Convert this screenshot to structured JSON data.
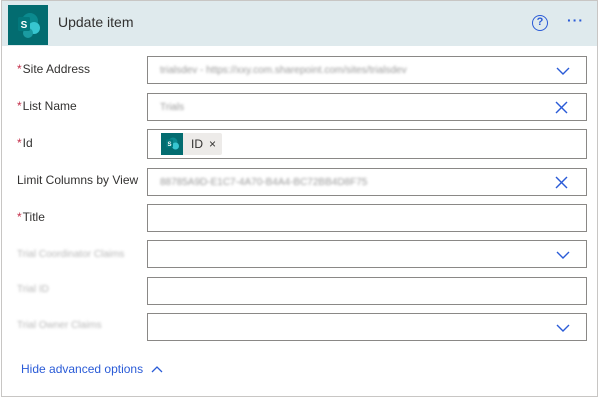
{
  "header": {
    "title": "Update item",
    "help_glyph": "?",
    "more_glyph": "···"
  },
  "fields": {
    "site_address": {
      "label": "Site Address",
      "required": "*",
      "value": "trialsdev - https://xxy.com.sharepoint.com/sites/trialsdev"
    },
    "list_name": {
      "label": "List Name",
      "required": "*",
      "value": "Trials"
    },
    "id": {
      "label": "Id",
      "required": "*",
      "token_label": "ID",
      "token_remove": "×"
    },
    "limit_columns": {
      "label": "Limit Columns by View",
      "value": "88785A9D-E1C7-4A70-B4A4-BC72BB4D8F75"
    },
    "title": {
      "label": "Title",
      "required": "*",
      "value": ""
    },
    "trial_coordinator_claims": {
      "label": "Trial Coordinator Claims"
    },
    "trial_id": {
      "label": "Trial ID"
    },
    "trial_owner_claims": {
      "label": "Trial Owner Claims"
    }
  },
  "footer": {
    "advanced_label": "Hide advanced options"
  },
  "colors": {
    "header_bg": "#dfeaed",
    "accent": "#2a5bd7",
    "sharepoint": "#036c70",
    "required": "#c4314b"
  }
}
